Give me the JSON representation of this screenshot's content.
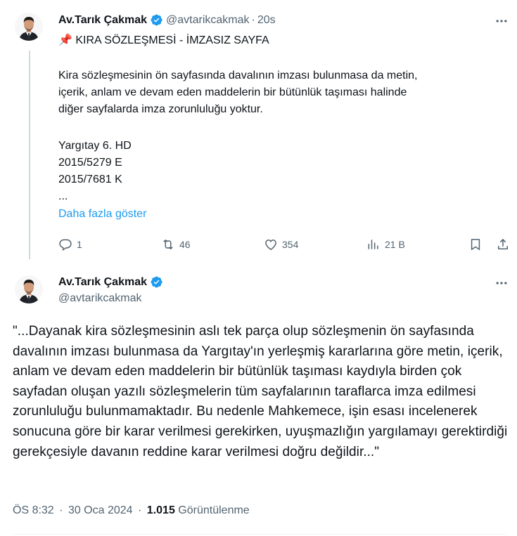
{
  "reply_tweet": {
    "author_name": "Av.Tarık Çakmak",
    "handle": "@avtarikcakmak",
    "separator": "·",
    "time": "20s",
    "pin_emoji": "📌",
    "title": "KIRA SÖZLEŞMESİ - İMZASIZ SAYFA",
    "body_lines": [
      "Kira sözleşmesinin ön sayfasında davalının imzası bulunmasa da metin,",
      "içerik, anlam ve devam eden maddelerin bir bütünlük taşıması halinde",
      "diğer sayfalarda imza zorunluluğu yoktur.",
      "Yargıtay 6. HD",
      "2015/5279 E",
      "2015/7681 K",
      "..."
    ],
    "show_more": "Daha fazla göster",
    "actions": {
      "replies": "1",
      "retweets": "46",
      "likes": "354",
      "views": "21 B"
    }
  },
  "main_tweet": {
    "author_name": "Av.Tarık Çakmak",
    "handle": "@avtarikcakmak",
    "text": "\"...Dayanak kira sözleşmesinin aslı tek parça olup sözleşmenin ön sayfasında davalının imzası bulunmasa da Yargıtay'ın yerleşmiş kararlarına göre metin, içerik, anlam ve devam eden maddelerin bir bütünlük taşıması kaydıyla birden çok sayfadan oluşan yazılı sözleşmelerin tüm sayfalarının taraflarca imza edilmesi zorunluluğu bulunmamaktadır. Bu nedenle Mahkemece, işin esası incelenerek sonucuna göre bir karar verilmesi gerekirken, uyuşmazlığın yargılamayı gerektirdiği gerekçesiyle davanın reddine karar verilmesi doğru değildir...\"",
    "time": "ÖS 8:32",
    "separator": "·",
    "date": "30 Oca 2024",
    "views_count": "1.015",
    "views_label": "Görüntülenme"
  },
  "icons": {
    "verified": "verified-badge-icon",
    "more": "more-dots-icon",
    "reply": "reply-icon",
    "retweet": "retweet-icon",
    "like": "heart-icon",
    "views": "views-chart-icon",
    "bookmark": "bookmark-icon",
    "share": "share-icon"
  },
  "colors": {
    "accent": "#1d9bf0",
    "secondary_text": "#536471",
    "primary_text": "#0f1419",
    "thread_line": "#cfd9de"
  }
}
